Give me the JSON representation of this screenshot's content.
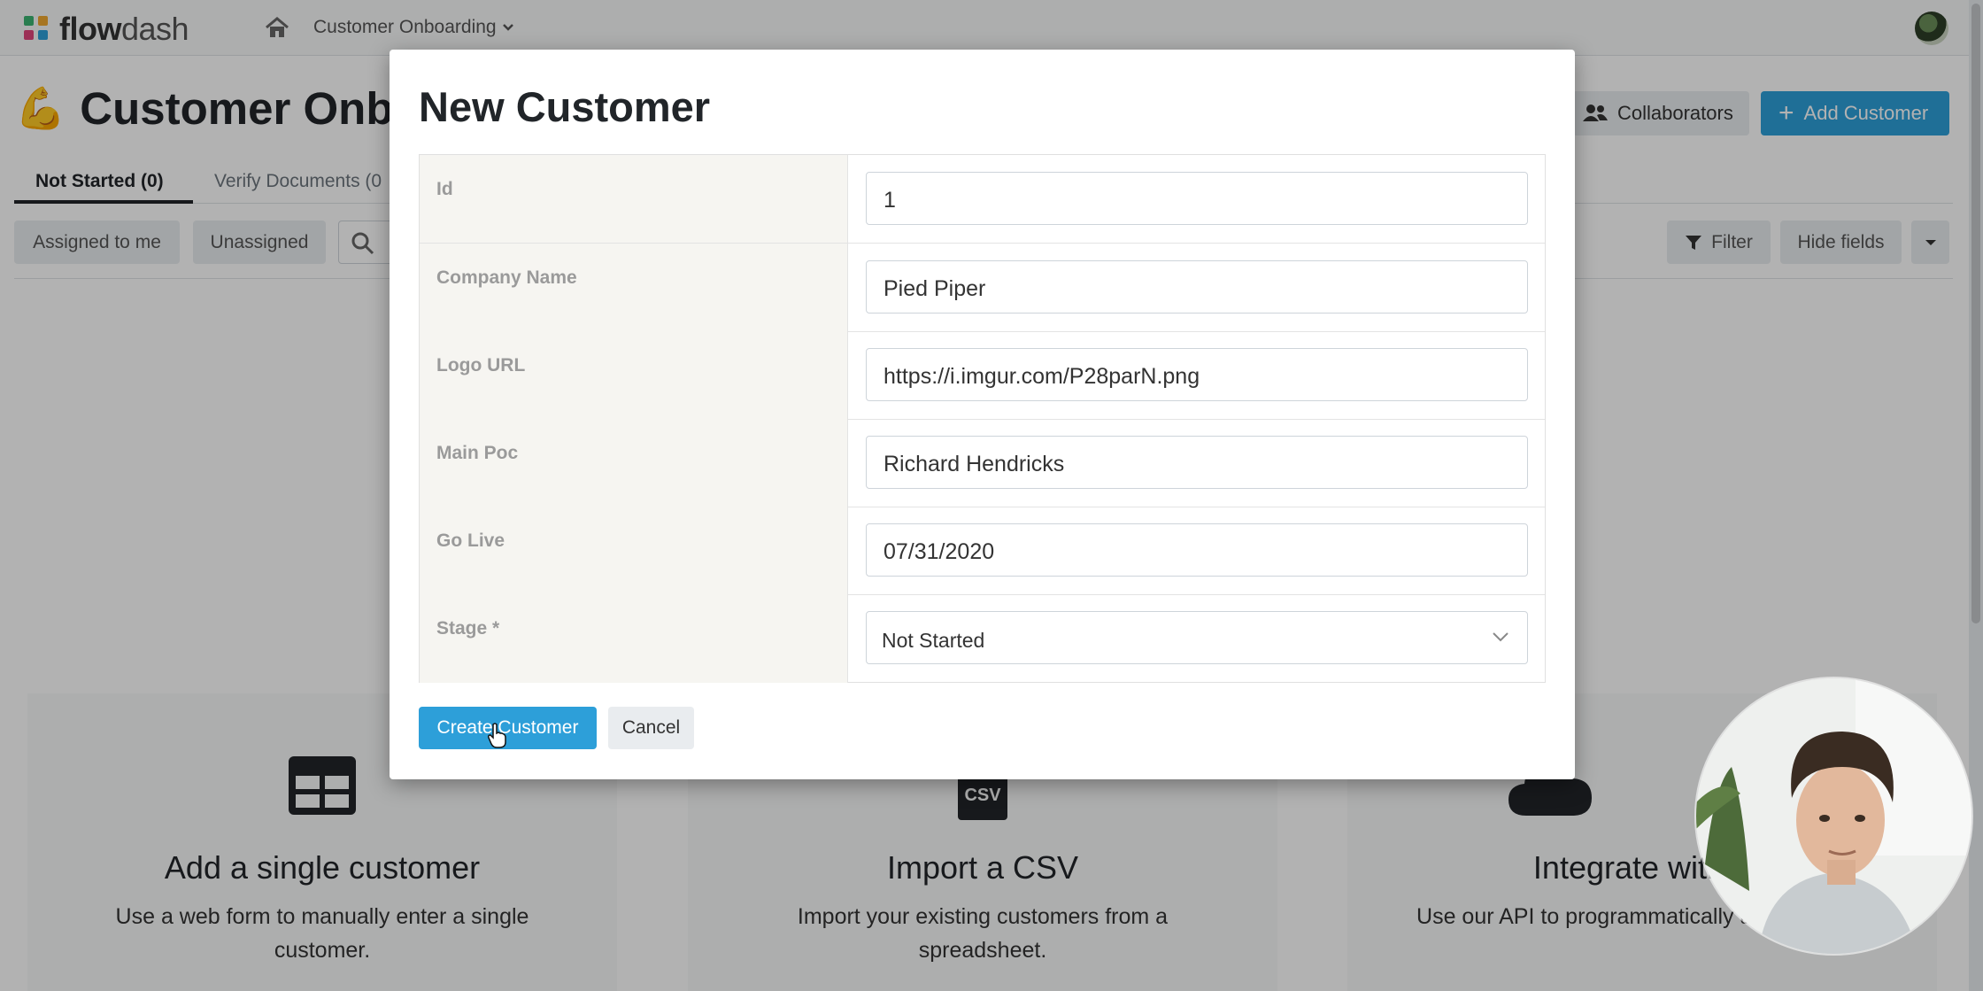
{
  "topbar": {
    "logo_bold": "flow",
    "logo_light": "dash",
    "breadcrumb": "Customer Onboarding"
  },
  "page": {
    "title": "Customer Onboa",
    "title_emoji": "💪",
    "collaborators_label": "Collaborators",
    "add_customer_label": "Add Customer"
  },
  "tabs": [
    {
      "label": "Not Started (0)"
    },
    {
      "label": "Verify Documents (0"
    }
  ],
  "filters": {
    "assigned_to_me": "Assigned to me",
    "unassigned": "Unassigned",
    "filter": "Filter",
    "hide_fields": "Hide fields"
  },
  "cards": [
    {
      "title": "Add a single customer",
      "desc": "Use a web form to manually enter a single customer."
    },
    {
      "title": "Import a CSV",
      "desc": "Import your existing customers from a spreadsheet."
    },
    {
      "title": "Integrate with o",
      "desc": "Use our API to programmatically a to this flow."
    }
  ],
  "modal": {
    "title": "New Customer",
    "fields": [
      {
        "label": "Id",
        "value": "1"
      },
      {
        "label": "Company Name",
        "value": "Pied Piper"
      },
      {
        "label": "Logo URL",
        "value": "https://i.imgur.com/P28parN.png"
      },
      {
        "label": "Main Poc",
        "value": "Richard Hendricks"
      },
      {
        "label": "Go Live",
        "value": "07/31/2020"
      },
      {
        "label": "Stage *",
        "value": "Not Started"
      }
    ],
    "create_label": "Create Customer",
    "cancel_label": "Cancel"
  },
  "colors": {
    "primary": "#2d9fd9",
    "backdrop": "rgba(0,0,0,0.30)"
  },
  "icons": [
    "home-icon",
    "chevron-down-icon",
    "users-icon",
    "plus-icon",
    "search-icon",
    "filter-icon",
    "table-icon",
    "csv-icon",
    "cloud-icon",
    "pointer-cursor-icon"
  ]
}
